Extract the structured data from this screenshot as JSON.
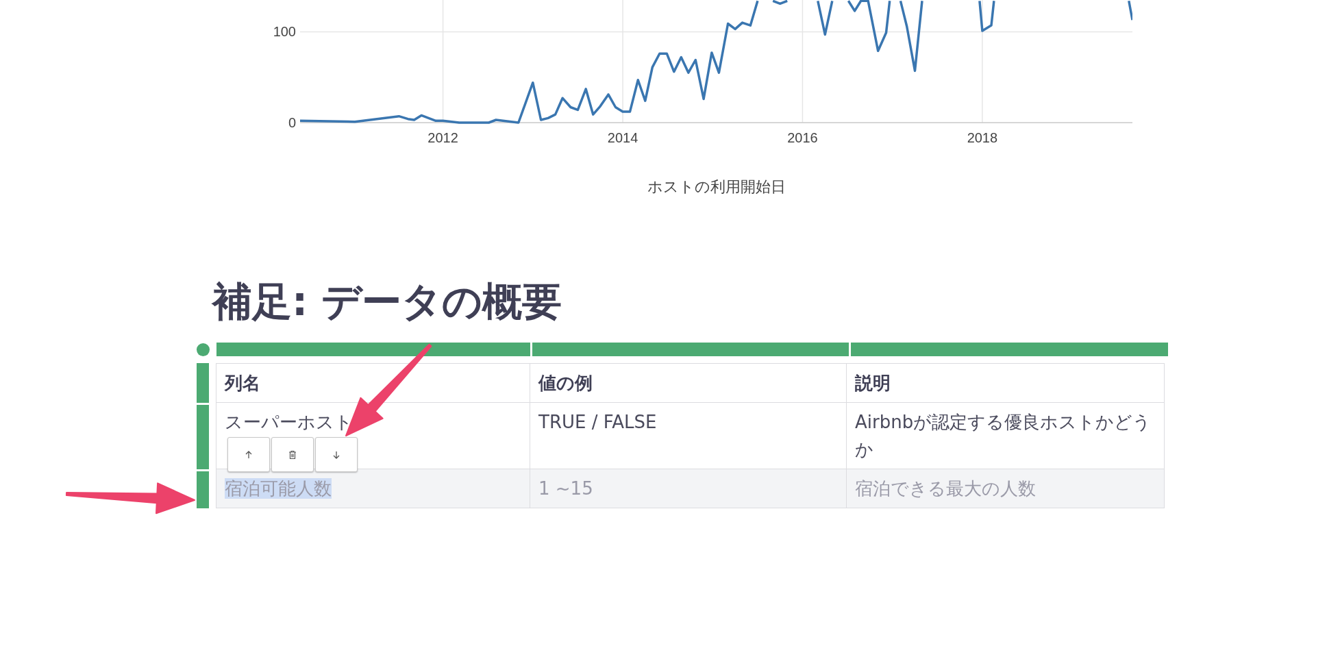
{
  "chart": {
    "chart_data": {
      "type": "line",
      "xlabel": "ホストの利用開始日",
      "color": "#3a76b0",
      "x": [
        2010.41,
        2011.02,
        2011.51,
        2011.61,
        2011.68,
        2011.76,
        2011.92,
        2012.0,
        2012.18,
        2012.51,
        2012.59,
        2012.84,
        2013.0,
        2013.09,
        2013.17,
        2013.25,
        2013.33,
        2013.42,
        2013.5,
        2013.59,
        2013.67,
        2013.75,
        2013.84,
        2013.92,
        2014.0,
        2014.08,
        2014.17,
        2014.25,
        2014.33,
        2014.41,
        2014.49,
        2014.57,
        2014.65,
        2014.73,
        2014.81,
        2014.9,
        2014.99,
        2015.07,
        2015.17,
        2015.25,
        2015.33,
        2015.42,
        2015.5,
        2015.58,
        2015.67,
        2015.75,
        2015.83,
        2015.92,
        2016.0,
        2016.08,
        2016.17,
        2016.25,
        2016.33,
        2016.41,
        2016.51,
        2016.58,
        2016.65,
        2016.73,
        2016.84,
        2016.93,
        2016.97,
        2017.03,
        2017.09,
        2017.16,
        2017.25,
        2017.33,
        2017.5,
        2017.7,
        2017.97,
        2018.0,
        2018.1,
        2018.13,
        2018.5,
        2019.0,
        2019.4,
        2019.63,
        2019.67
      ],
      "values": [
        2,
        1,
        7,
        4,
        3,
        8,
        2,
        2,
        0,
        0,
        3,
        0,
        44,
        3,
        5,
        9,
        27,
        17,
        14,
        37,
        9,
        18,
        31,
        17,
        12,
        12,
        47,
        24,
        61,
        76,
        76,
        56,
        72,
        55,
        69,
        26,
        77,
        55,
        109,
        103,
        110,
        107,
        134,
        null,
        134,
        131,
        134,
        null,
        null,
        null,
        134,
        97,
        134,
        null,
        134,
        123,
        134,
        134,
        79,
        99,
        134,
        null,
        134,
        106,
        57,
        134,
        null,
        null,
        134,
        101,
        107,
        134,
        null,
        null,
        null,
        134,
        113
      ],
      "grid": true,
      "xlim": [
        2010.41,
        2019.67
      ],
      "ylim": [
        0,
        135
      ],
      "xticks": [
        2012,
        2014,
        2016,
        2018
      ],
      "yticks": [
        0,
        100
      ]
    }
  },
  "heading": "補足: データの概要",
  "table": {
    "columns": [
      "列名",
      "値の例",
      "説明"
    ],
    "rows": [
      {
        "selected": false,
        "cells": [
          {
            "text": "スーパーホスト",
            "text_selected": false
          },
          {
            "text": "TRUE / FALSE",
            "text_selected": false
          },
          {
            "text": "Airbnbが認定する優良ホストかどうか",
            "text_selected": false
          }
        ]
      },
      {
        "selected": true,
        "cells": [
          {
            "text": "宿泊可能人数",
            "text_selected": true
          },
          {
            "text": "1 ~15",
            "text_selected": false
          },
          {
            "text": "宿泊できる最大の人数",
            "text_selected": false
          }
        ]
      }
    ]
  },
  "row_toolbar": [
    {
      "kind": "move_up"
    },
    {
      "kind": "delete"
    },
    {
      "kind": "move_down"
    }
  ],
  "callouts": [
    {
      "kind": "arrow"
    },
    {
      "kind": "arrow"
    }
  ]
}
